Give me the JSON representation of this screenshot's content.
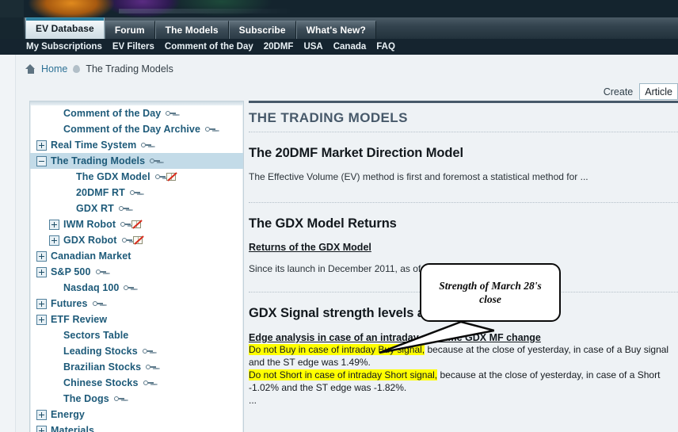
{
  "site": {
    "tabs": [
      {
        "label": "EV Database",
        "active": true
      },
      {
        "label": "Forum",
        "active": false
      },
      {
        "label": "The Models",
        "active": false
      },
      {
        "label": "Subscribe",
        "active": false
      },
      {
        "label": "What's New?",
        "active": false
      }
    ],
    "subnav": [
      "My Subscriptions",
      "EV Filters",
      "Comment of the Day",
      "20DMF",
      "USA",
      "Canada",
      "FAQ"
    ]
  },
  "breadcrumb": {
    "home_icon": "home-icon",
    "home": "Home",
    "separator_icon": "breadcrumb-separator-icon",
    "current": "The Trading Models"
  },
  "create": {
    "label": "Create",
    "selected": "Article"
  },
  "sidebar": {
    "items": [
      {
        "label": "Comment of the Day",
        "indent": 1,
        "toggle": "none",
        "key": true,
        "book": false,
        "selected": false
      },
      {
        "label": "Comment of the Day Archive",
        "indent": 1,
        "toggle": "none",
        "key": true,
        "book": false,
        "selected": false
      },
      {
        "label": "Real Time System",
        "indent": 0,
        "toggle": "plus",
        "key": true,
        "book": false,
        "selected": false
      },
      {
        "label": "The Trading Models",
        "indent": 0,
        "toggle": "minus",
        "key": true,
        "book": false,
        "selected": true
      },
      {
        "label": "The GDX Model",
        "indent": 2,
        "toggle": "none",
        "key": true,
        "book": true,
        "selected": false
      },
      {
        "label": "20DMF RT",
        "indent": 2,
        "toggle": "none",
        "key": true,
        "book": false,
        "selected": false
      },
      {
        "label": "GDX RT",
        "indent": 2,
        "toggle": "none",
        "key": true,
        "book": false,
        "selected": false
      },
      {
        "label": "IWM Robot",
        "indent": 1,
        "toggle": "plus",
        "key": true,
        "book": true,
        "selected": false
      },
      {
        "label": "GDX Robot",
        "indent": 1,
        "toggle": "plus",
        "key": true,
        "book": true,
        "selected": false
      },
      {
        "label": "Canadian Market",
        "indent": 0,
        "toggle": "plus",
        "key": false,
        "book": false,
        "selected": false
      },
      {
        "label": "S&P 500",
        "indent": 0,
        "toggle": "plus",
        "key": true,
        "book": false,
        "selected": false
      },
      {
        "label": "Nasdaq 100",
        "indent": 1,
        "toggle": "none",
        "key": true,
        "book": false,
        "selected": false
      },
      {
        "label": "Futures",
        "indent": 0,
        "toggle": "plus",
        "key": true,
        "book": false,
        "selected": false
      },
      {
        "label": "ETF Review",
        "indent": 0,
        "toggle": "plus",
        "key": false,
        "book": false,
        "selected": false
      },
      {
        "label": "Sectors Table",
        "indent": 1,
        "toggle": "none",
        "key": false,
        "book": false,
        "selected": false
      },
      {
        "label": "Leading Stocks",
        "indent": 1,
        "toggle": "none",
        "key": true,
        "book": false,
        "selected": false
      },
      {
        "label": "Brazilian Stocks",
        "indent": 1,
        "toggle": "none",
        "key": true,
        "book": false,
        "selected": false
      },
      {
        "label": "Chinese Stocks",
        "indent": 1,
        "toggle": "none",
        "key": true,
        "book": false,
        "selected": false
      },
      {
        "label": "The Dogs",
        "indent": 1,
        "toggle": "none",
        "key": true,
        "book": false,
        "selected": false
      },
      {
        "label": "Energy",
        "indent": 0,
        "toggle": "plus",
        "key": false,
        "book": false,
        "selected": false
      },
      {
        "label": "Materials",
        "indent": 0,
        "toggle": "plus",
        "key": false,
        "book": false,
        "selected": false
      }
    ]
  },
  "main": {
    "section_title": "THE TRADING MODELS",
    "block1": {
      "heading": "The 20DMF Market Direction Model",
      "text": "The Effective Volume (EV) method is first and foremost a statistical method for ..."
    },
    "block2": {
      "heading": "The GDX Model Returns",
      "link": "Returns of the GDX Model",
      "text": "Since its launch in December 2011, as of ..."
    },
    "block3": {
      "heading": "GDX Signal strength levels and real time updates",
      "subheading": "Edge analysis in case of an intraday real time GDX MF change",
      "line1_hl": "Do not Buy in case of intraday Buy signal,",
      "line1_rest": " because at the close of yesterday, in case of a Buy signal",
      "line2": "and the ST edge was 1.49%.",
      "line3_hl": "Do not Short in case of intraday Short signal,",
      "line3_rest": " because at the close of yesterday, in case of a Short",
      "line4": "-1.02% and the ST edge was -1.82%.",
      "line5": "..."
    }
  },
  "callout": {
    "text": "Strength of March 28's close"
  },
  "colors": {
    "nav_dark": "#15242f",
    "tab_active_top": "#2e7f9e",
    "heading_blue": "#47596a",
    "tree_link": "#1d5a79",
    "tree_selected_bg": "#c3dbe8",
    "highlight_yellow": "#ffff00",
    "link_blue": "#2e7296",
    "page_bg": "#eef2f5"
  }
}
